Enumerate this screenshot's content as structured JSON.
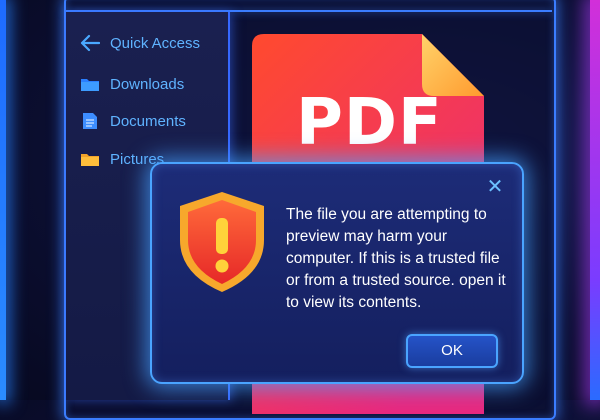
{
  "sidebar": {
    "back_label": "Quick Access",
    "items": [
      {
        "label": "Downloads",
        "icon": "downloads-folder-icon"
      },
      {
        "label": "Documents",
        "icon": "document-icon"
      },
      {
        "label": "Pictures",
        "icon": "pictures-folder-icon"
      }
    ]
  },
  "preview": {
    "file_type_label": "PDF"
  },
  "dialog": {
    "icon": "warning-shield-icon",
    "message": "The file you are attempting to preview may harm your computer. If this is a trusted file or from a trusted source. open it to view its contents.",
    "ok_label": "OK",
    "close_icon": "close-icon"
  },
  "colors": {
    "accent": "#4aa4ff",
    "nav_text": "#5fb3ff",
    "pdf_gradient_top": "#ff4a2e",
    "pdf_gradient_bottom": "#e8287f",
    "warning": "#ff3b2f"
  }
}
